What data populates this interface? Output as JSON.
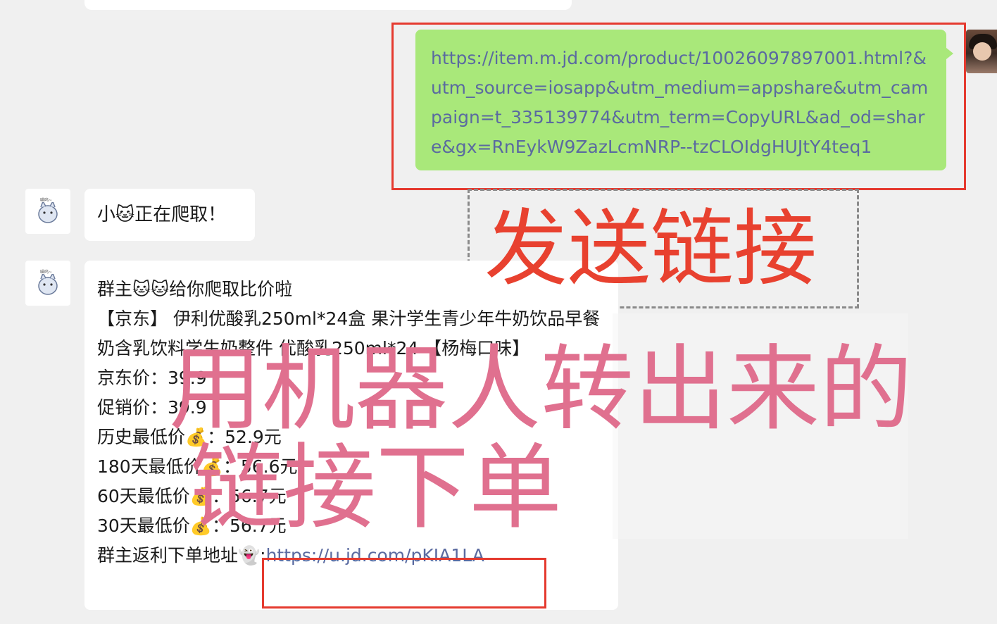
{
  "sent_message": {
    "url": "https://item.m.jd.com/product/10026097897001.html?&utm_source=iosapp&utm_medium=appshare&utm_campaign=t_335139774&utm_term=CopyURL&ad_od=share&gx=RnEykW9ZazLcmNRP--tzCLOIdgHUJtY4teq1"
  },
  "bot_message_1": {
    "text": "小🐱正在爬取！"
  },
  "bot_message_2": {
    "greeting": "群主🐱🐱给你爬取比价啦",
    "product": "【京东】 伊利优酸乳250ml*24盒 果汁学生青少年牛奶饮品早餐奶含乳饮料学生奶整件 优酸乳250ml*24 【杨梅口味】",
    "jd_price": "京东价：39.9",
    "promo_price": "促销价：39.9",
    "history_low": "历史最低价💰：52.9元",
    "low_180": "180天最低价💰：56.6元",
    "low_60": "60天最低价💰：56.7元",
    "low_30": "30天最低价💰：56.7元",
    "rebate_label": "群主返利下单地址👻:",
    "rebate_link": "https://u.jd.com/pKIA1LA"
  },
  "annotations": {
    "send_link": "发送链接",
    "robot_line1": "用机器人转出来的",
    "robot_line2": "链接下单"
  },
  "colors": {
    "sent_bubble": "#a9e87a",
    "link": "#5a6aa0",
    "highlight_red": "#e53a2f",
    "caption_pink": "#e0708f"
  }
}
